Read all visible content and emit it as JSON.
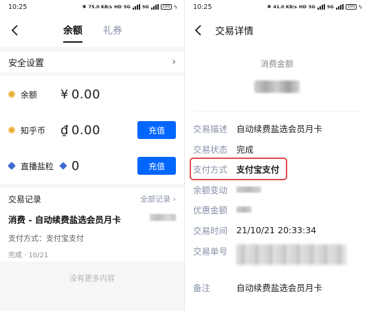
{
  "left": {
    "status": {
      "time": "10:25",
      "net_speed": "75.0 KB/s",
      "network_tags": [
        "HD",
        "5G",
        "5G"
      ],
      "battery": "100"
    },
    "tabs": [
      {
        "label": "余额",
        "active": true
      },
      {
        "label": "礼券",
        "active": false
      }
    ],
    "security": {
      "label": "安全设置"
    },
    "assets": [
      {
        "name": "余额",
        "symbol": "¥",
        "value": "0.00",
        "icon": "coin-icon",
        "has_recharge": false
      },
      {
        "name": "知乎币",
        "symbol": "₫",
        "value": "0.00",
        "icon": "coin-icon",
        "has_recharge": true,
        "recharge_label": "充值"
      },
      {
        "name": "直播盐粒",
        "symbol": "",
        "value": "0",
        "icon": "gem-icon",
        "has_recharge": true,
        "recharge_label": "充值"
      }
    ],
    "records": {
      "title": "交易记录",
      "all_label": "全部记录",
      "item": {
        "title": "消费 - 自动续费盐选会员月卡",
        "method": "支付方式：支付宝支付",
        "status": "完成 · 10/21",
        "amount": "(blurred)"
      }
    },
    "no_more": "没有更多内容"
  },
  "right": {
    "status": {
      "time": "10:25",
      "net_speed": "41.0 KB/s",
      "network_tags": [
        "HD",
        "5G",
        "5G"
      ],
      "battery": "100"
    },
    "title": "交易详情",
    "amount_label": "消费金额",
    "details": [
      {
        "label": "交易描述",
        "value": "自动续费盐选会员月卡"
      },
      {
        "label": "交易状态",
        "value": "完成"
      },
      {
        "label": "支付方式",
        "value": "支付宝支付",
        "highlighted": true
      },
      {
        "label": "余额变动",
        "value": ""
      },
      {
        "label": "优惠金额",
        "value": ""
      },
      {
        "label": "交易时间",
        "value": "21/10/21 20:33:34"
      },
      {
        "label": "交易单号",
        "value": ""
      },
      {
        "label": "备注",
        "value": "自动续费盐选会员月卡"
      }
    ],
    "highlight_color": "#e14a4a"
  },
  "colors": {
    "accent": "#0066ff",
    "secondary_text": "#8590a6",
    "page_bg": "#f6f6f6"
  }
}
